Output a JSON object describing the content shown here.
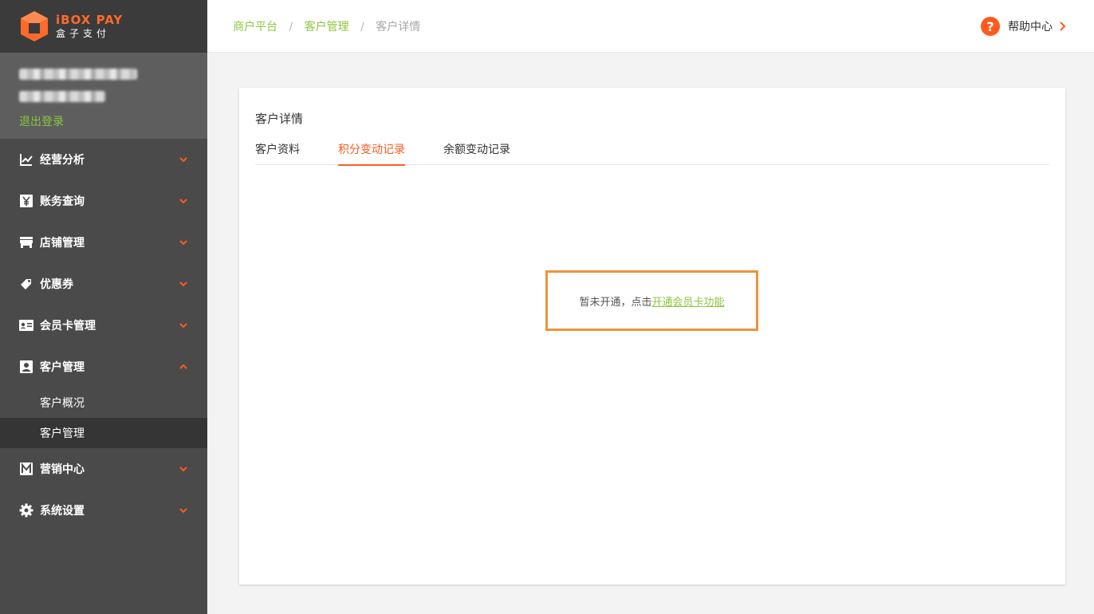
{
  "logo": {
    "brand_en": "iBOX PAY",
    "brand_cn": "盒子支付"
  },
  "user": {
    "logout_label": "退出登录"
  },
  "sidebar": {
    "items": [
      {
        "label": "经营分析",
        "icon": "chart-line-icon"
      },
      {
        "label": "账务查询",
        "icon": "yen-icon"
      },
      {
        "label": "店铺管理",
        "icon": "store-icon"
      },
      {
        "label": "优惠券",
        "icon": "coupon-icon"
      },
      {
        "label": "会员卡管理",
        "icon": "member-card-icon"
      },
      {
        "label": "客户管理",
        "icon": "customer-icon",
        "expanded": true,
        "children": [
          {
            "label": "客户概况"
          },
          {
            "label": "客户管理",
            "active": true
          }
        ]
      },
      {
        "label": "营销中心",
        "icon": "marketing-icon"
      },
      {
        "label": "系统设置",
        "icon": "gear-icon"
      }
    ]
  },
  "breadcrumb": {
    "home": "商户平台",
    "section": "客户管理",
    "current": "客户详情",
    "separator": "/"
  },
  "help": {
    "badge": "?",
    "label": "帮助中心"
  },
  "card": {
    "title": "客户详情",
    "tabs": [
      {
        "label": "客户资料"
      },
      {
        "label": "积分变动记录",
        "active": true
      },
      {
        "label": "余额变动记录"
      }
    ],
    "notice_text": "暂未开通，点击",
    "notice_link": "开通会员卡功能"
  },
  "colors": {
    "accent": "#ff5a1f",
    "green": "#8cc63f",
    "sidebar": "#4a4a4a",
    "highlight_border": "#f0923a"
  }
}
